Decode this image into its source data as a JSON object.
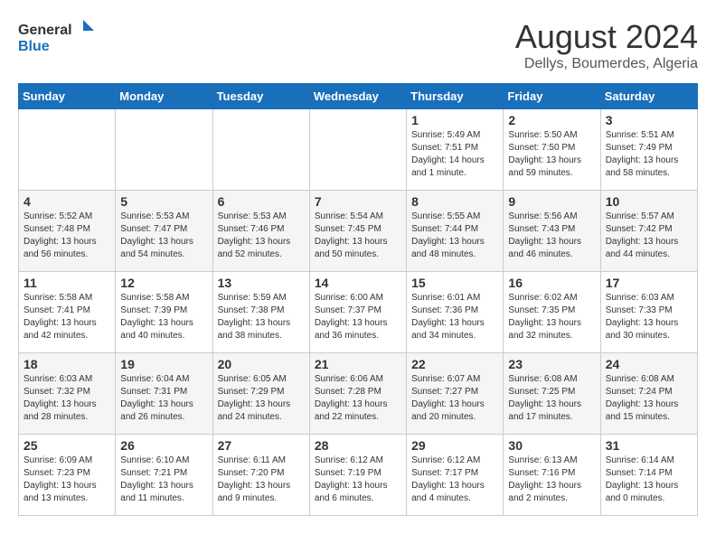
{
  "logo": {
    "line1": "General",
    "line2": "Blue"
  },
  "title": "August 2024",
  "location": "Dellys, Boumerdes, Algeria",
  "days_of_week": [
    "Sunday",
    "Monday",
    "Tuesday",
    "Wednesday",
    "Thursday",
    "Friday",
    "Saturday"
  ],
  "weeks": [
    [
      {
        "day": "",
        "info": ""
      },
      {
        "day": "",
        "info": ""
      },
      {
        "day": "",
        "info": ""
      },
      {
        "day": "",
        "info": ""
      },
      {
        "day": "1",
        "info": "Sunrise: 5:49 AM\nSunset: 7:51 PM\nDaylight: 14 hours\nand 1 minute."
      },
      {
        "day": "2",
        "info": "Sunrise: 5:50 AM\nSunset: 7:50 PM\nDaylight: 13 hours\nand 59 minutes."
      },
      {
        "day": "3",
        "info": "Sunrise: 5:51 AM\nSunset: 7:49 PM\nDaylight: 13 hours\nand 58 minutes."
      }
    ],
    [
      {
        "day": "4",
        "info": "Sunrise: 5:52 AM\nSunset: 7:48 PM\nDaylight: 13 hours\nand 56 minutes."
      },
      {
        "day": "5",
        "info": "Sunrise: 5:53 AM\nSunset: 7:47 PM\nDaylight: 13 hours\nand 54 minutes."
      },
      {
        "day": "6",
        "info": "Sunrise: 5:53 AM\nSunset: 7:46 PM\nDaylight: 13 hours\nand 52 minutes."
      },
      {
        "day": "7",
        "info": "Sunrise: 5:54 AM\nSunset: 7:45 PM\nDaylight: 13 hours\nand 50 minutes."
      },
      {
        "day": "8",
        "info": "Sunrise: 5:55 AM\nSunset: 7:44 PM\nDaylight: 13 hours\nand 48 minutes."
      },
      {
        "day": "9",
        "info": "Sunrise: 5:56 AM\nSunset: 7:43 PM\nDaylight: 13 hours\nand 46 minutes."
      },
      {
        "day": "10",
        "info": "Sunrise: 5:57 AM\nSunset: 7:42 PM\nDaylight: 13 hours\nand 44 minutes."
      }
    ],
    [
      {
        "day": "11",
        "info": "Sunrise: 5:58 AM\nSunset: 7:41 PM\nDaylight: 13 hours\nand 42 minutes."
      },
      {
        "day": "12",
        "info": "Sunrise: 5:58 AM\nSunset: 7:39 PM\nDaylight: 13 hours\nand 40 minutes."
      },
      {
        "day": "13",
        "info": "Sunrise: 5:59 AM\nSunset: 7:38 PM\nDaylight: 13 hours\nand 38 minutes."
      },
      {
        "day": "14",
        "info": "Sunrise: 6:00 AM\nSunset: 7:37 PM\nDaylight: 13 hours\nand 36 minutes."
      },
      {
        "day": "15",
        "info": "Sunrise: 6:01 AM\nSunset: 7:36 PM\nDaylight: 13 hours\nand 34 minutes."
      },
      {
        "day": "16",
        "info": "Sunrise: 6:02 AM\nSunset: 7:35 PM\nDaylight: 13 hours\nand 32 minutes."
      },
      {
        "day": "17",
        "info": "Sunrise: 6:03 AM\nSunset: 7:33 PM\nDaylight: 13 hours\nand 30 minutes."
      }
    ],
    [
      {
        "day": "18",
        "info": "Sunrise: 6:03 AM\nSunset: 7:32 PM\nDaylight: 13 hours\nand 28 minutes."
      },
      {
        "day": "19",
        "info": "Sunrise: 6:04 AM\nSunset: 7:31 PM\nDaylight: 13 hours\nand 26 minutes."
      },
      {
        "day": "20",
        "info": "Sunrise: 6:05 AM\nSunset: 7:29 PM\nDaylight: 13 hours\nand 24 minutes."
      },
      {
        "day": "21",
        "info": "Sunrise: 6:06 AM\nSunset: 7:28 PM\nDaylight: 13 hours\nand 22 minutes."
      },
      {
        "day": "22",
        "info": "Sunrise: 6:07 AM\nSunset: 7:27 PM\nDaylight: 13 hours\nand 20 minutes."
      },
      {
        "day": "23",
        "info": "Sunrise: 6:08 AM\nSunset: 7:25 PM\nDaylight: 13 hours\nand 17 minutes."
      },
      {
        "day": "24",
        "info": "Sunrise: 6:08 AM\nSunset: 7:24 PM\nDaylight: 13 hours\nand 15 minutes."
      }
    ],
    [
      {
        "day": "25",
        "info": "Sunrise: 6:09 AM\nSunset: 7:23 PM\nDaylight: 13 hours\nand 13 minutes."
      },
      {
        "day": "26",
        "info": "Sunrise: 6:10 AM\nSunset: 7:21 PM\nDaylight: 13 hours\nand 11 minutes."
      },
      {
        "day": "27",
        "info": "Sunrise: 6:11 AM\nSunset: 7:20 PM\nDaylight: 13 hours\nand 9 minutes."
      },
      {
        "day": "28",
        "info": "Sunrise: 6:12 AM\nSunset: 7:19 PM\nDaylight: 13 hours\nand 6 minutes."
      },
      {
        "day": "29",
        "info": "Sunrise: 6:12 AM\nSunset: 7:17 PM\nDaylight: 13 hours\nand 4 minutes."
      },
      {
        "day": "30",
        "info": "Sunrise: 6:13 AM\nSunset: 7:16 PM\nDaylight: 13 hours\nand 2 minutes."
      },
      {
        "day": "31",
        "info": "Sunrise: 6:14 AM\nSunset: 7:14 PM\nDaylight: 13 hours\nand 0 minutes."
      }
    ]
  ]
}
